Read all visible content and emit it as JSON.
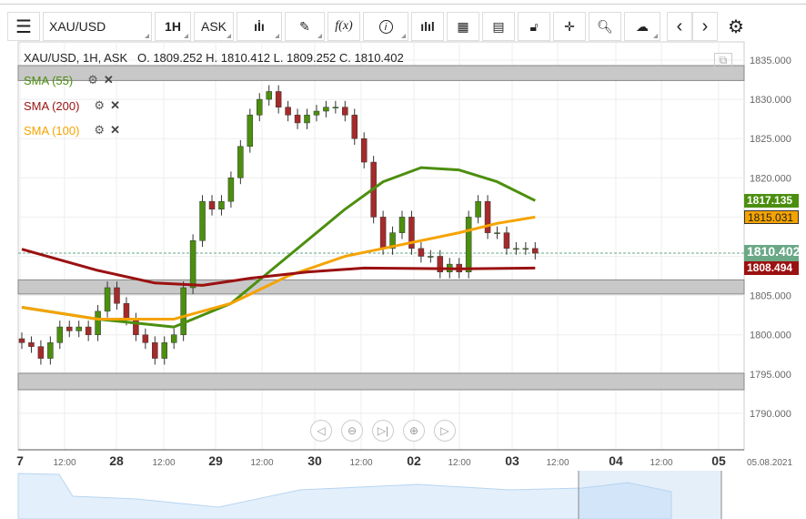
{
  "toolbar": {
    "symbol": "XAU/USD",
    "timeframe": "1H",
    "price_type": "ASK",
    "items": [
      "menu-icon",
      "chart-type-icon",
      "draw-icon",
      "indicator-icon",
      "info-icon",
      "volume-icon",
      "calendar-icon",
      "report-icon",
      "lock-icon",
      "crosshair-icon",
      "zoom-icon",
      "upload-icon",
      "prev-icon",
      "next-icon",
      "gear-icon"
    ],
    "fx_label": "f(x)"
  },
  "header": {
    "ohlc": "XAU/USD, 1H, ASK   O. 1809.252 H. 1810.412 L. 1809.252 C. 1810.402"
  },
  "indicators": [
    {
      "label": "SMA (55)",
      "color": "#4c8f0f"
    },
    {
      "label": "SMA (200)",
      "color": "#9b1111"
    },
    {
      "label": "SMA (100)",
      "color": "#f5a300"
    }
  ],
  "price_tags": [
    {
      "value": "1817.135",
      "color": "#4c8f0f",
      "price": 1817.135
    },
    {
      "value": "1815.031",
      "color": "#f5a300",
      "price": 1815.031
    },
    {
      "value": "1810.402",
      "color": "#6aa886",
      "price": 1810.402
    },
    {
      "value": "1808.494",
      "color": "#9b1111",
      "price": 1808.494
    }
  ],
  "chart_data": {
    "type": "candlestick",
    "ylim": [
      1787,
      1836
    ],
    "yticks": [
      "1835.000",
      "1830.000",
      "1825.000",
      "1820.000",
      "1815.000",
      "1810.000",
      "1805.000",
      "1800.000",
      "1795.000",
      "1790.000"
    ],
    "xticks": [
      "7",
      "12:00",
      "28",
      "12:00",
      "29",
      "12:00",
      "30",
      "12:00",
      "02",
      "12:00",
      "03",
      "12:00",
      "04",
      "12:00",
      "05",
      "05.08.2021"
    ],
    "closes": [
      1799,
      1798.5,
      1797,
      1799,
      1801,
      1800.5,
      1801,
      1800,
      1803,
      1806,
      1804,
      1802,
      1800,
      1799,
      1797,
      1799,
      1800,
      1806,
      1812,
      1817,
      1816,
      1817,
      1820,
      1824,
      1828,
      1830,
      1831,
      1829,
      1828,
      1827,
      1828,
      1828.5,
      1829,
      1829,
      1828,
      1825,
      1822,
      1815,
      1811,
      1813,
      1815,
      1811,
      1810,
      1810,
      1808,
      1809,
      1808,
      1815,
      1817,
      1813,
      1813,
      1811,
      1811,
      1811,
      1810.402
    ],
    "sma55": [
      [
        0,
        1803.5
      ],
      [
        8,
        1802
      ],
      [
        16,
        1801
      ],
      [
        22,
        1804
      ],
      [
        28,
        1810
      ],
      [
        34,
        1816
      ],
      [
        38,
        1819.5
      ],
      [
        42,
        1821.3
      ],
      [
        46,
        1821
      ],
      [
        50,
        1819.5
      ],
      [
        54,
        1817.1
      ]
    ],
    "sma100": [
      [
        0,
        1803.5
      ],
      [
        8,
        1802
      ],
      [
        16,
        1802
      ],
      [
        22,
        1804
      ],
      [
        28,
        1807.5
      ],
      [
        34,
        1810
      ],
      [
        40,
        1811.5
      ],
      [
        46,
        1813
      ],
      [
        50,
        1814.2
      ],
      [
        54,
        1815
      ]
    ],
    "sma200": [
      [
        0,
        1810.9
      ],
      [
        8,
        1808.2
      ],
      [
        14,
        1806.6
      ],
      [
        19,
        1806.3
      ],
      [
        24,
        1807.2
      ],
      [
        30,
        1808
      ],
      [
        36,
        1808.5
      ],
      [
        46,
        1808.4
      ],
      [
        54,
        1808.5
      ]
    ],
    "bands": [
      [
        1832.4,
        1834.3
      ],
      [
        1805.2,
        1807.0
      ],
      [
        1793.0,
        1795.1
      ]
    ],
    "last_price": 1810.402
  }
}
